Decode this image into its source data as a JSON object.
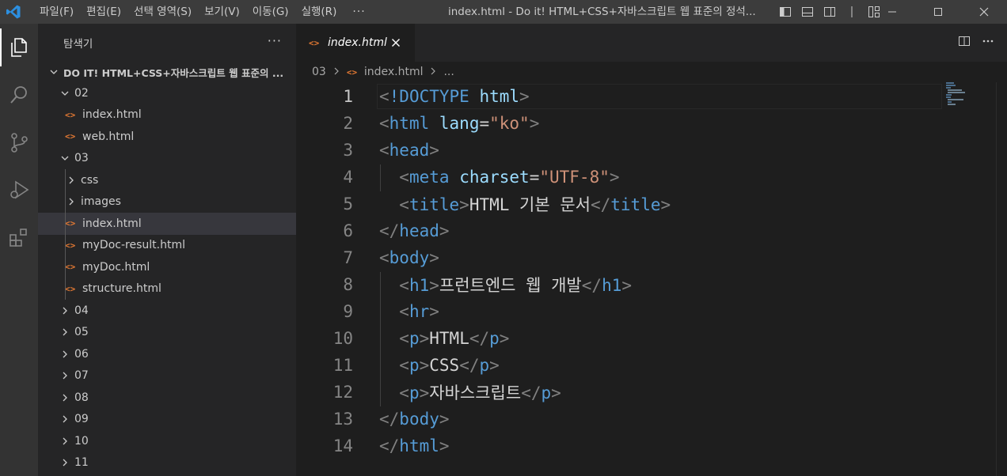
{
  "titlebar": {
    "menus": [
      "파일(F)",
      "편집(E)",
      "선택 영역(S)",
      "보기(V)",
      "이동(G)",
      "실행(R)"
    ],
    "more": "···",
    "window_title": "index.html - Do it! HTML+CSS+자바스크립트 웹 표준의 정석..."
  },
  "sidebar": {
    "title": "탐색기",
    "more": "···",
    "root": "DO IT! HTML+CSS+자바스크립트 웹 표준의 ...",
    "folder_02": "02",
    "f02_index": "index.html",
    "f02_web": "web.html",
    "folder_03": "03",
    "f03_css": "css",
    "f03_images": "images",
    "f03_index": "index.html",
    "f03_mydoc_result": "myDoc-result.html",
    "f03_mydoc": "myDoc.html",
    "f03_structure": "structure.html",
    "folders": [
      "04",
      "05",
      "06",
      "07",
      "08",
      "09",
      "10",
      "11"
    ]
  },
  "editor": {
    "tab_label": "index.html",
    "breadcrumb_folder": "03",
    "breadcrumb_file": "index.html",
    "breadcrumb_more": "...",
    "line_numbers": [
      "1",
      "2",
      "3",
      "4",
      "5",
      "6",
      "7",
      "8",
      "9",
      "10",
      "11",
      "12",
      "13",
      "14"
    ],
    "code": {
      "l1_doctype": "!DOCTYPE",
      "l1_html": "html",
      "l2_tag": "html",
      "l2_attr": "lang",
      "l2_val": "\"ko\"",
      "l3_tag": "head",
      "l4_tag": "meta",
      "l4_attr": "charset",
      "l4_val": "\"UTF-8\"",
      "l5_tag": "title",
      "l5_text": "HTML 기본 문서",
      "l6_tag": "head",
      "l7_tag": "body",
      "l8_tag": "h1",
      "l8_text": "프런트엔드 웹 개발",
      "l9_tag": "hr",
      "l10_tag": "p",
      "l10_text": "HTML",
      "l11_tag": "p",
      "l11_text": "CSS",
      "l12_tag": "p",
      "l12_text": "자바스크립트",
      "l13_tag": "body",
      "l14_tag": "html"
    }
  },
  "colors": {
    "accent_html_icon": "#e37933",
    "tag": "#569cd6",
    "attr": "#9cdcfe",
    "string": "#ce9178"
  }
}
